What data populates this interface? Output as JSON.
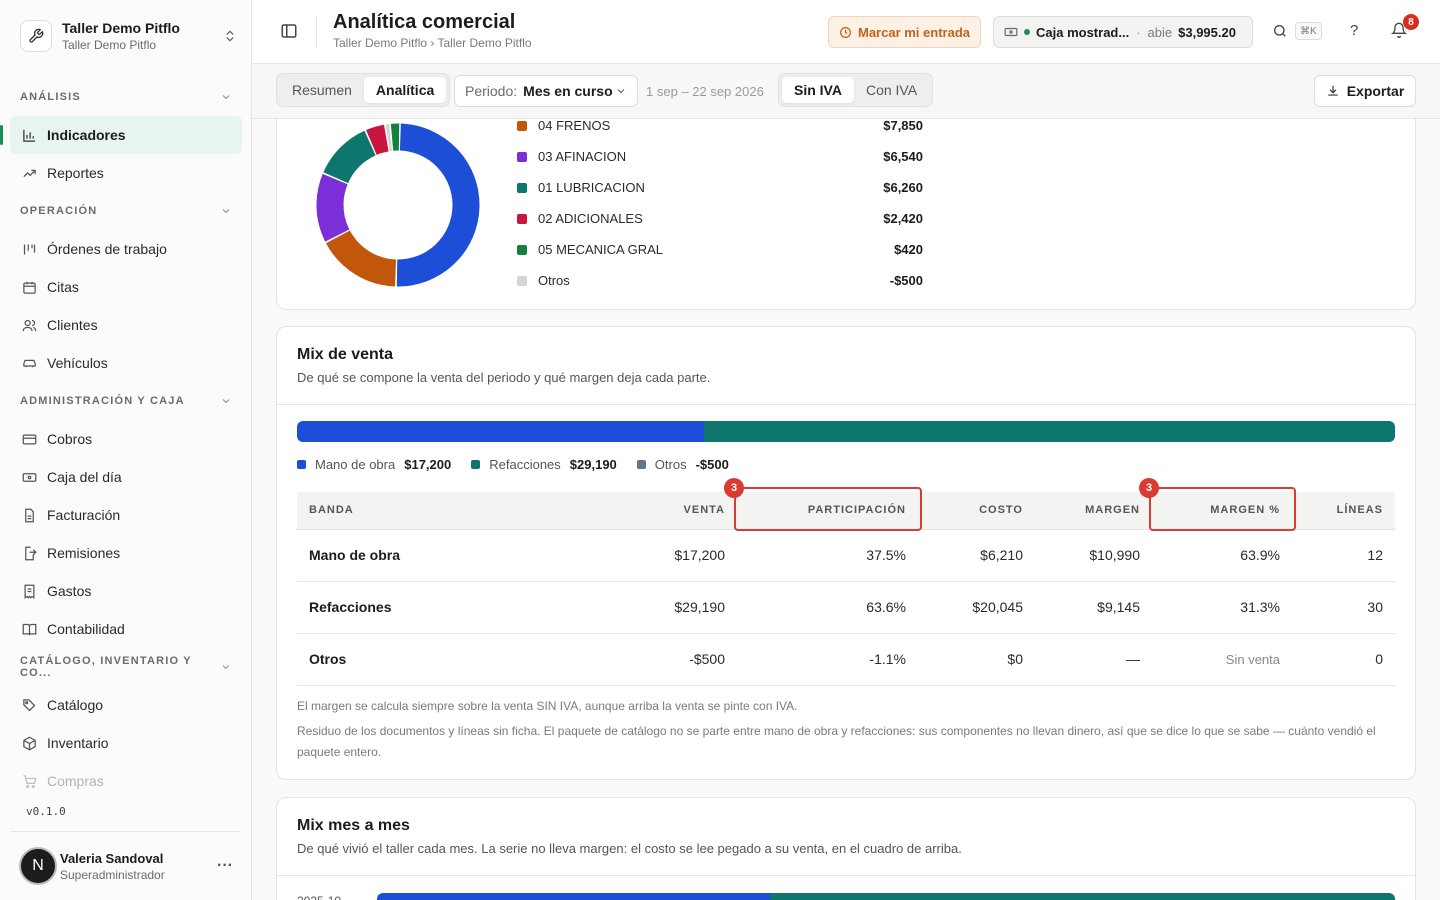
{
  "org": {
    "name": "Taller Demo Pitflo",
    "sub": "Taller Demo Pitflo"
  },
  "nav": {
    "sections": [
      {
        "label": "ANÁLISIS",
        "items": [
          "Indicadores",
          "Reportes"
        ]
      },
      {
        "label": "OPERACIÓN",
        "items": [
          "Órdenes de trabajo",
          "Citas",
          "Clientes",
          "Vehículos"
        ]
      },
      {
        "label": "ADMINISTRACIÓN Y CAJA",
        "items": [
          "Cobros",
          "Caja del día",
          "Facturación",
          "Remisiones",
          "Gastos",
          "Contabilidad"
        ]
      },
      {
        "label": "CATÁLOGO, INVENTARIO Y CO...",
        "items": [
          "Catálogo",
          "Inventario",
          "Compras"
        ]
      }
    ],
    "active": "Indicadores"
  },
  "version": "v0.1.0",
  "user": {
    "initial": "N",
    "name": "Valeria Sandoval",
    "role": "Superadministrador"
  },
  "header": {
    "title": "Analítica comercial",
    "breadcrumb": "Taller Demo Pitflo › Taller Demo Pitflo",
    "clock_label": "Marcar mi entrada",
    "cash_name": "Caja mostrad...",
    "cash_sep": "·",
    "cash_state": "abie",
    "cash_amount": "$3,995.20",
    "kbd": "⌘K",
    "help": "?",
    "notif_count": "8"
  },
  "toolbar": {
    "view_tabs": [
      "Resumen",
      "Analítica"
    ],
    "view_active": "Analítica",
    "period_label": "Periodo:",
    "period_value": "Mes en curso",
    "date_range": "1 sep – 22 sep 2026",
    "tax_tabs": [
      "Sin IVA",
      "Con IVA"
    ],
    "tax_active": "Sin IVA",
    "export_label": "Exportar"
  },
  "colors": {
    "accent": "#1d8a5a",
    "labor": "#1d4ed8",
    "parts": "#0f766e",
    "other": "#64748b",
    "highlight": "#d93a32"
  },
  "category_breakdown": {
    "items": [
      {
        "name": "04 FRENOS",
        "amount": "$7,850",
        "color": "#c2570c"
      },
      {
        "name": "03 AFINACION",
        "amount": "$6,540",
        "color": "#7c2fd6"
      },
      {
        "name": "01 LUBRICACION",
        "amount": "$6,260",
        "color": "#0f766e"
      },
      {
        "name": "02 ADICIONALES",
        "amount": "$2,420",
        "color": "#c8163f"
      },
      {
        "name": "05 MECANICA GRAL",
        "amount": "$420",
        "color": "#15803d"
      },
      {
        "name": "Otros",
        "amount": "-$500",
        "color": "#d4d4d0"
      }
    ]
  },
  "mix": {
    "title": "Mix de venta",
    "subtitle": "De qué se compone la venta del periodo y qué margen deja cada parte.",
    "bar_shares": [
      0.371,
      0.629
    ],
    "legend": [
      {
        "name": "Mano de obra",
        "amount": "$17,200",
        "color": "#1d4ed8"
      },
      {
        "name": "Refacciones",
        "amount": "$29,190",
        "color": "#0f766e"
      },
      {
        "name": "Otros",
        "amount": "-$500",
        "color": "#64748b"
      }
    ],
    "columns": [
      "BANDA",
      "VENTA",
      "PARTICIPACIÓN",
      "COSTO",
      "MARGEN",
      "MARGEN %",
      "LÍNEAS"
    ],
    "rows": [
      [
        "Mano de obra",
        "$17,200",
        "37.5%",
        "$6,210",
        "$10,990",
        "63.9%",
        "12"
      ],
      [
        "Refacciones",
        "$29,190",
        "63.6%",
        "$20,045",
        "$9,145",
        "31.3%",
        "30"
      ],
      [
        "Otros",
        "-$500",
        "-1.1%",
        "$0",
        "—",
        "Sin venta",
        "0"
      ]
    ],
    "highlight_badges": [
      "3",
      "3"
    ],
    "note1": "El margen se calcula siempre sobre la venta SIN IVA, aunque arriba la venta se pinte con IVA.",
    "note2": "Residuo de los documentos y líneas sin ficha. El paquete de catálogo no se parte entre mano de obra y refacciones: sus componentes no llevan dinero, así que se dice lo que se sabe — cuánto vendió el paquete entero."
  },
  "monthly": {
    "title": "Mix mes a mes",
    "subtitle": "De qué vivió el taller cada mes. La serie no lleva margen: el costo se lee pegado a su venta, en el cuadro de arriba.",
    "first_month": "2025-10",
    "first_month_shares": [
      0.386,
      0.614
    ]
  }
}
